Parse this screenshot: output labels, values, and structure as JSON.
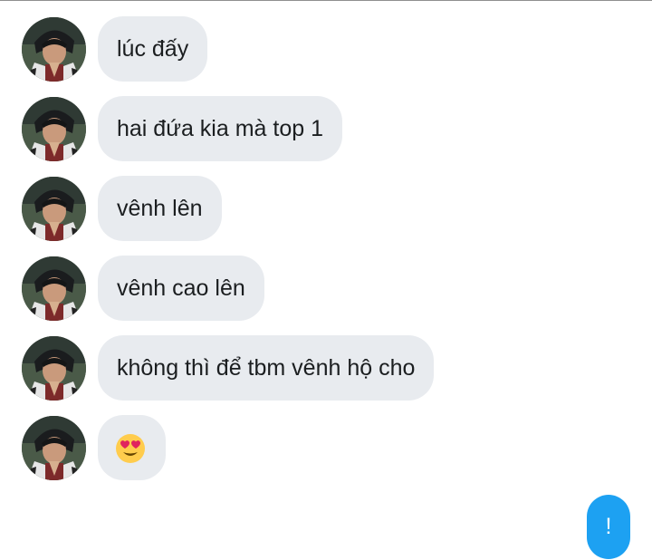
{
  "conversation": {
    "messages": [
      {
        "sender": "other",
        "text": "lúc đấy"
      },
      {
        "sender": "other",
        "text": "hai đứa kia mà top 1"
      },
      {
        "sender": "other",
        "text": "vênh lên"
      },
      {
        "sender": "other",
        "text": "vênh cao lên"
      },
      {
        "sender": "other",
        "text": "không thì để tbm vênh hộ cho"
      },
      {
        "sender": "other",
        "emoji": "heart-eyes-face-icon"
      }
    ],
    "sent": {
      "text": "!"
    }
  },
  "colors": {
    "received_bubble": "#e8ebef",
    "sent_bubble": "#1da1f2",
    "text": "#1b1e20"
  }
}
